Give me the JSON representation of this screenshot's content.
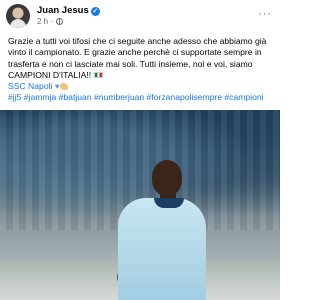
{
  "post": {
    "author": "Juan Jesus",
    "time": "2 h",
    "more_label": "···",
    "lines": [
      "Grazie a tutti voi tifosi che ci seguite anche adesso che abbiamo già",
      "vinto il campionato. E grazie anche perchè ci supportate sempre in",
      "trasferta e non ci lasciate mai soli. Tutti insieme, noi e voi, siamo",
      "CAMPIONI D'ITALIA!!"
    ],
    "mention": "SSC Napoli",
    "hashtags": "#jj5 #jammja #batjuan #numberjuan #forzanapolisempre #campioni"
  },
  "icons": {
    "verified": "verified-badge-icon",
    "globe": "globe-icon",
    "flag": "italy-flag-icon",
    "heart": "blue-heart-icon",
    "arm": "flexed-biceps-icon"
  },
  "colors": {
    "link": "#1877f2",
    "meta": "#65676b"
  }
}
